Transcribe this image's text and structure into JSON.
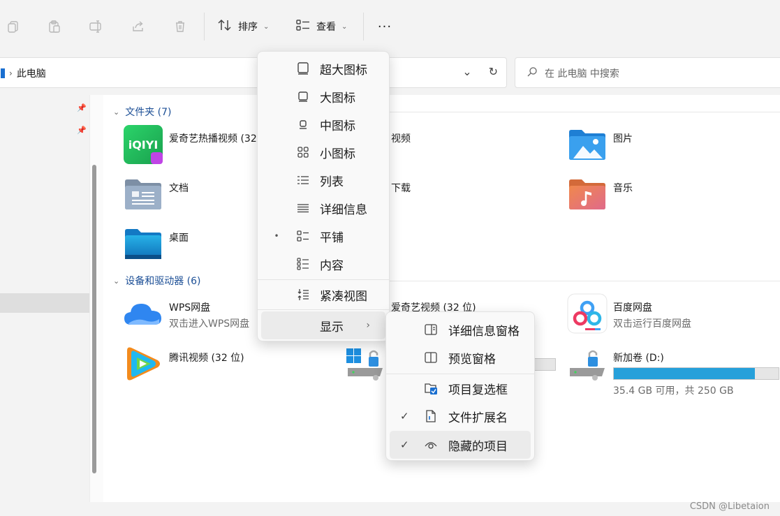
{
  "toolbar": {
    "copy_icon": "copy-icon",
    "paste_icon": "paste-icon",
    "rename_icon": "rename-icon",
    "share_icon": "share-icon",
    "delete_icon": "delete-icon",
    "sort_label": "排序",
    "view_label": "查看",
    "more_label": "···"
  },
  "address": {
    "path": "此电脑",
    "search_placeholder": "在 此电脑 中搜索"
  },
  "groups": {
    "folders_title": "文件夹 (7)",
    "drives_title": "设备和驱动器 (6)"
  },
  "folders": [
    {
      "name": "爱奇艺热播视频 (32"
    },
    {
      "name": "视频"
    },
    {
      "name": "图片"
    },
    {
      "name": "文档"
    },
    {
      "name": "下载"
    },
    {
      "name": "音乐"
    },
    {
      "name": "桌面"
    }
  ],
  "drives": [
    {
      "name": "WPS网盘",
      "sub": "双击进入WPS网盘"
    },
    {
      "name": "爱奇艺视频 (32 位)"
    },
    {
      "name": "百度网盘",
      "sub": "双击运行百度网盘"
    },
    {
      "name": "腾讯视频 (32 位)"
    },
    {
      "name": "新加卷 (D:)",
      "sub": "35.4 GB 可用，共 250 GB",
      "used_fraction": 0.858
    }
  ],
  "view_menu": {
    "items": [
      {
        "label": "超大图标"
      },
      {
        "label": "大图标"
      },
      {
        "label": "中图标"
      },
      {
        "label": "小图标"
      },
      {
        "label": "列表"
      },
      {
        "label": "详细信息"
      },
      {
        "label": "平铺",
        "selected": true
      },
      {
        "label": "内容"
      },
      {
        "label": "紧凑视图"
      },
      {
        "label": "显示"
      }
    ],
    "bullet": "•",
    "arrow": "›"
  },
  "show_submenu": {
    "items": [
      {
        "label": "详细信息窗格"
      },
      {
        "label": "预览窗格"
      },
      {
        "label": "项目复选框"
      },
      {
        "label": "文件扩展名",
        "checked": true
      },
      {
        "label": "隐藏的项目",
        "checked": true
      }
    ],
    "check": "✓"
  },
  "watermark": "CSDN @Libetaion",
  "colors": {
    "accent": "#26a0da",
    "link": "#1c4f96"
  }
}
